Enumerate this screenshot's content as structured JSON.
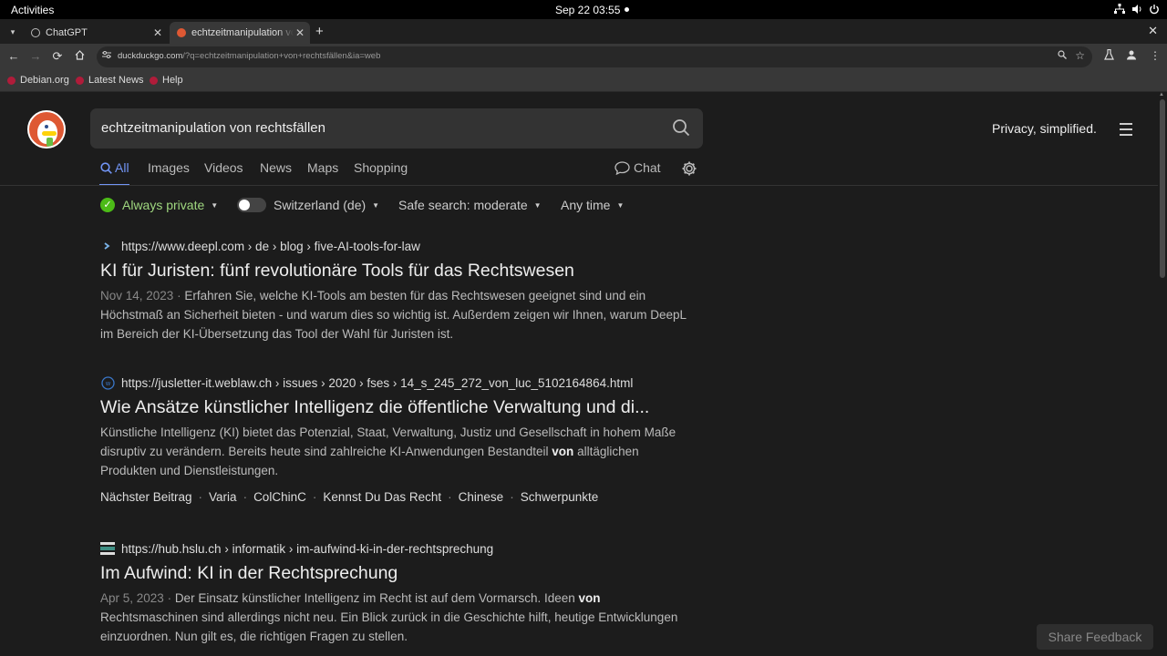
{
  "system_bar": {
    "activities": "Activities",
    "clock": "Sep 22  03:55"
  },
  "browser": {
    "tabs": [
      {
        "title": "ChatGPT",
        "active": false
      },
      {
        "title": "echtzeitmanipulation von",
        "active": true
      }
    ],
    "url_host": "duckduckgo.com",
    "url_path": "/?q=echtzeitmanipulation+von+rechtsfällen&ia=web",
    "bookmarks": [
      {
        "label": "Debian.org"
      },
      {
        "label": "Latest News"
      },
      {
        "label": "Help"
      }
    ]
  },
  "search": {
    "query": "echtzeitmanipulation von rechtsfällen",
    "tagline": "Privacy, simplified.",
    "tabs": [
      {
        "label": "All",
        "active": true
      },
      {
        "label": "Images"
      },
      {
        "label": "Videos"
      },
      {
        "label": "News"
      },
      {
        "label": "Maps"
      },
      {
        "label": "Shopping"
      }
    ],
    "chat_label": "Chat",
    "filters": {
      "privacy": "Always private",
      "region": "Switzerland (de)",
      "safe_search": "Safe search: moderate",
      "time": "Any time"
    }
  },
  "results": [
    {
      "url": "https://www.deepl.com › de › blog › five-AI-tools-for-law",
      "title": "KI für Juristen: fünf revolutionäre Tools für das Rechtswesen",
      "date": "Nov 14, 2023",
      "snippet": "Erfahren Sie, welche KI-Tools am besten für das Rechtswesen geeignet sind und ein Höchstmaß an Sicherheit bieten - und warum dies so wichtig ist. Außerdem zeigen wir Ihnen, warum DeepL im Bereich der KI-Übersetzung das Tool der Wahl für Juristen ist."
    },
    {
      "url": "https://jusletter-it.weblaw.ch › issues › 2020 › fses › 14_s_245_272_von_luc_5102164864.html",
      "title": "Wie Ansätze künstlicher Intelligenz die öffentliche Verwaltung und di...",
      "snippet_pre": "Künstliche Intelligenz (KI) bietet das Potenzial, Staat, Verwaltung, Justiz und Gesellschaft in hohem Maße disruptiv zu verändern. Bereits heute sind zahlreiche KI-Anwendungen Bestandteil ",
      "snippet_bold": "von",
      "snippet_post": " alltäglichen Produkten und Dienstleistungen.",
      "sitelinks": [
        "Nächster Beitrag",
        "Varia",
        "ColChinC",
        "Kennst Du Das Recht",
        "Chinese",
        "Schwerpunkte"
      ]
    },
    {
      "url": "https://hub.hslu.ch › informatik › im-aufwind-ki-in-der-rechtsprechung",
      "title": "Im Aufwind: KI in der Rechtsprechung",
      "date": "Apr 5, 2023",
      "snippet_pre": "Der Einsatz künstlicher Intelligenz im Recht ist auf dem Vormarsch. Ideen ",
      "snippet_bold": "von",
      "snippet_post": " Rechtsmaschinen sind allerdings nicht neu. Ein Blick zurück in die Geschichte hilft, heutige Entwicklungen einzuordnen. Nun gilt es, die richtigen Fragen zu stellen."
    }
  ],
  "feedback_label": "Share Feedback",
  "colors": {
    "accent": "#7295f6",
    "ddg_orange": "#de5833",
    "private_green": "#4cbb17"
  }
}
